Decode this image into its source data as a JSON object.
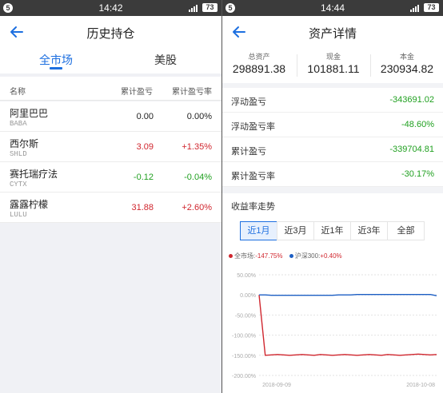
{
  "status_left": {
    "badge": "5",
    "time": "14:42",
    "battery": "73"
  },
  "status_right": {
    "badge": "5",
    "time": "14:44",
    "battery": "73"
  },
  "left": {
    "title": "历史持仓",
    "tabs": [
      {
        "label": "全市场",
        "active": true
      },
      {
        "label": "美股",
        "active": false
      }
    ],
    "columns": {
      "name": "名称",
      "pnl": "累计盈亏",
      "pnl_rate": "累计盈亏率"
    },
    "rows": [
      {
        "name": "阿里巴巴",
        "code": "BABA",
        "pnl": "0.00",
        "rate": "0.00%",
        "color": "#222222"
      },
      {
        "name": "西尔斯",
        "code": "SHLD",
        "pnl": "3.09",
        "rate": "+1.35%",
        "color": "#d0262e"
      },
      {
        "name": "赛托瑞疗法",
        "code": "CYTX",
        "pnl": "-0.12",
        "rate": "-0.04%",
        "color": "#20a020"
      },
      {
        "name": "露露柠檬",
        "code": "LULU",
        "pnl": "31.88",
        "rate": "+2.60%",
        "color": "#d0262e"
      }
    ]
  },
  "right": {
    "title": "资产详情",
    "summary": [
      {
        "label": "总资产",
        "value": "298891.38"
      },
      {
        "label": "现金",
        "value": "101881.11"
      },
      {
        "label": "本金",
        "value": "230934.82"
      }
    ],
    "metrics": [
      {
        "label": "浮动盈亏",
        "value": "-343691.02"
      },
      {
        "label": "浮动盈亏率",
        "value": "-48.60%"
      },
      {
        "label": "累计盈亏",
        "value": "-339704.81"
      },
      {
        "label": "累计盈亏率",
        "value": "-30.17%"
      }
    ],
    "trend_title": "收益率走势",
    "periods": [
      {
        "label": "近1月",
        "selected": true
      },
      {
        "label": "近3月",
        "selected": false
      },
      {
        "label": "近1年",
        "selected": false
      },
      {
        "label": "近3年",
        "selected": false
      },
      {
        "label": "全部",
        "selected": false
      }
    ],
    "legend": {
      "market": {
        "label": "全市场:",
        "value": "-147.75%",
        "color": "#d0262e"
      },
      "hs300": {
        "label": "沪深300:",
        "value": "+0.40%",
        "color": "#1d5fc4"
      }
    }
  },
  "chart_data": {
    "type": "line",
    "ylim": [
      -200,
      50
    ],
    "y_ticks": [
      "50.00%",
      "0.00%",
      "-50.00%",
      "-100.00%",
      "-150.00%",
      "-200.00%"
    ],
    "y_tick_values": [
      50,
      0,
      -50,
      -100,
      -150,
      -200
    ],
    "x_labels": [
      "2018-09-09",
      "2018-10-08"
    ],
    "grid": true,
    "series": [
      {
        "name": "全市场",
        "color": "#d0262e",
        "values": [
          0,
          -150,
          -149,
          -148,
          -149,
          -150,
          -149,
          -148,
          -149,
          -150,
          -148,
          -149,
          -150,
          -149,
          -148,
          -149,
          -150,
          -149,
          -148,
          -149,
          -150,
          -148,
          -149,
          -150,
          -149,
          -148,
          -147,
          -148,
          -149,
          -148
        ]
      },
      {
        "name": "沪深300",
        "color": "#1d5fc4",
        "values": [
          0,
          0,
          -1,
          -1,
          -1,
          -1,
          -1,
          -1,
          -1,
          -1,
          -1,
          -1,
          -1,
          0,
          0,
          0,
          1,
          1,
          1,
          1,
          1,
          1,
          1,
          1,
          1,
          1,
          1,
          1,
          1,
          -2
        ]
      }
    ]
  }
}
